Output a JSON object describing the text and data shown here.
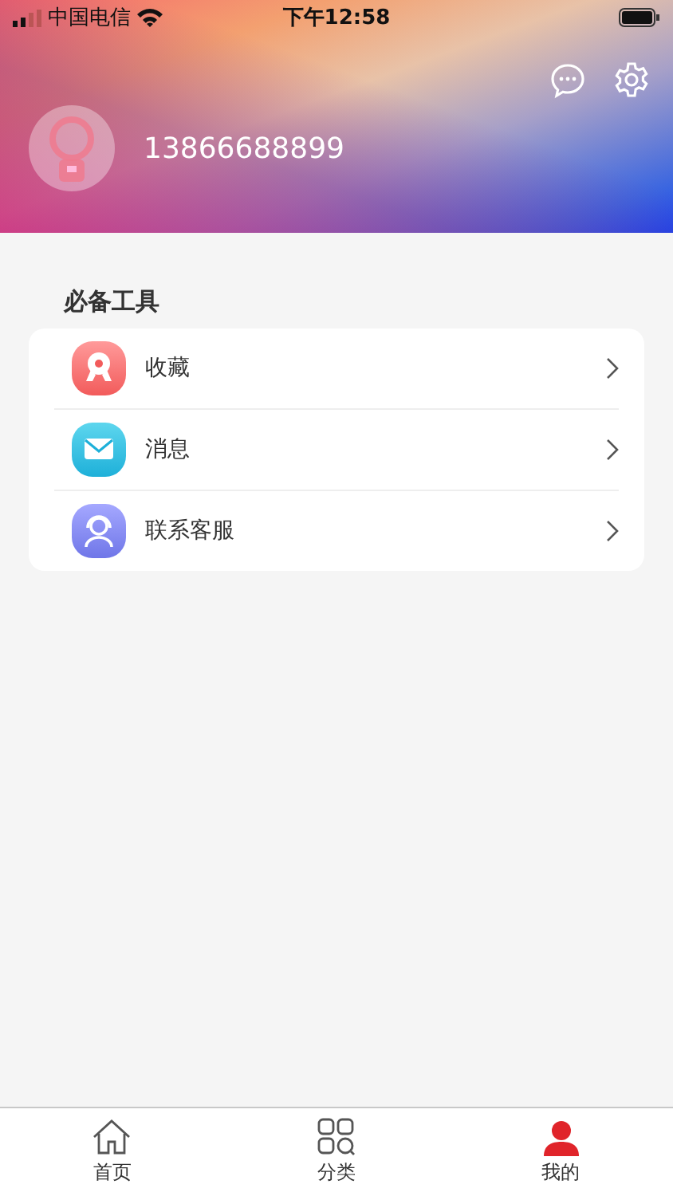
{
  "status_bar": {
    "carrier": "中国电信",
    "time": "下午12:58"
  },
  "profile": {
    "phone": "13866688899"
  },
  "section": {
    "title": "必备工具"
  },
  "tools": [
    {
      "kind": "collect",
      "label": "收藏"
    },
    {
      "kind": "message",
      "label": "消息"
    },
    {
      "kind": "service",
      "label": "联系客服"
    }
  ],
  "tab_bar": [
    {
      "kind": "home",
      "label": "首页",
      "selected": false
    },
    {
      "kind": "category",
      "label": "分类",
      "selected": false
    },
    {
      "kind": "profile",
      "label": "我的",
      "selected": true
    }
  ]
}
